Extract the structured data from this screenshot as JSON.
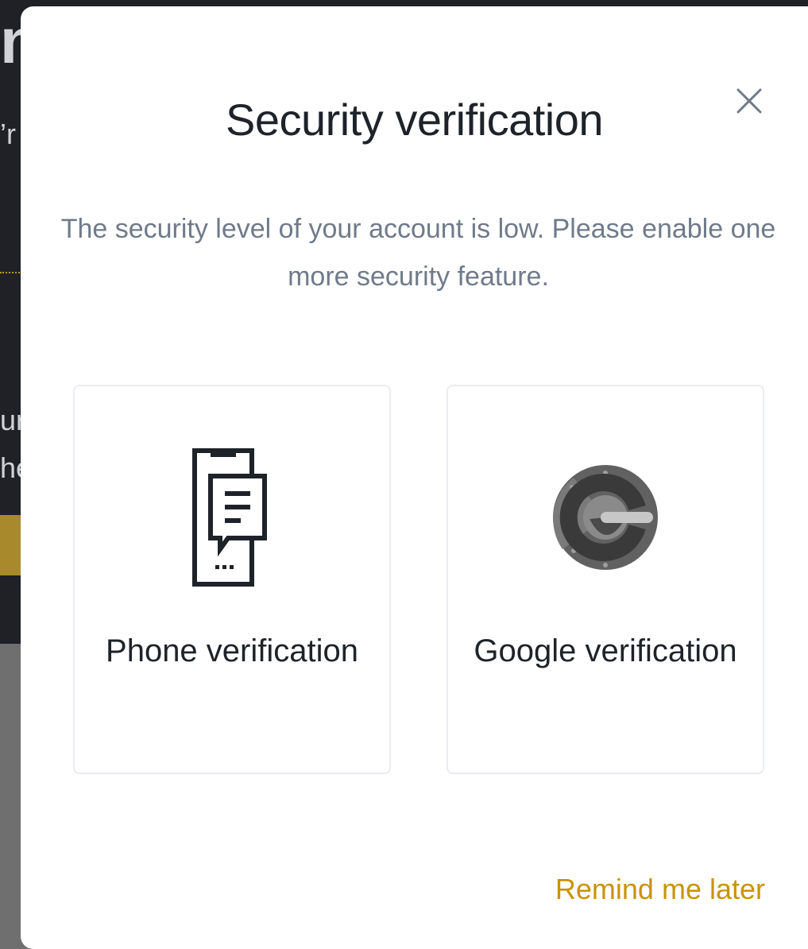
{
  "background": {
    "fragment_top": "n",
    "fragment_2": "’r",
    "fragment_3": "ur",
    "fragment_4": "he"
  },
  "modal": {
    "title": "Security verification",
    "message": "The security level of your account is low. Please enable one more security feature.",
    "close_icon": "close-icon",
    "options": [
      {
        "id": "phone",
        "icon": "phone-message-icon",
        "label": "Phone verification"
      },
      {
        "id": "google",
        "icon": "google-authenticator-icon",
        "label": "Google verification"
      }
    ],
    "remind_label": "Remind me later"
  },
  "colors": {
    "accent": "#c99400",
    "title": "#1e2329",
    "message": "#707a8a",
    "border": "#eaecef"
  }
}
